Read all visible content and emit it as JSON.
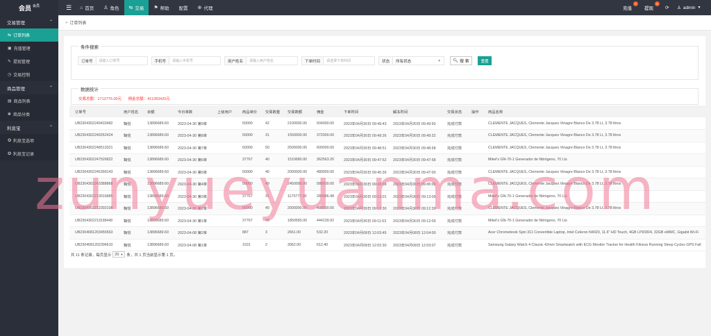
{
  "brand": {
    "title": "会员",
    "subtitle": "会员"
  },
  "topnav": [
    {
      "label": "首页",
      "icon": "home-icon",
      "glyph": "⌂"
    },
    {
      "label": "角色",
      "icon": "user-icon",
      "glyph": "♙"
    },
    {
      "label": "交易",
      "icon": "trade-icon",
      "glyph": "⇆"
    },
    {
      "label": "帮助",
      "icon": "flag-icon",
      "glyph": "⚑"
    },
    {
      "label": "配置",
      "icon": "config-icon",
      "glyph": ""
    },
    {
      "label": "代理",
      "icon": "agent-icon",
      "glyph": "⊕"
    }
  ],
  "topright": {
    "recharge": "充值",
    "recharge_badge": "0",
    "withdraw": "提现",
    "withdraw_badge": "0",
    "user": "admin"
  },
  "sidebar": {
    "groups": [
      {
        "label": "交易管理",
        "items": [
          {
            "label": "订单列表",
            "glyph": "⇆"
          },
          {
            "label": "充值管理",
            "glyph": "▣"
          },
          {
            "label": "提现管理",
            "glyph": "✎"
          },
          {
            "label": "交易控制",
            "glyph": "◷"
          }
        ]
      },
      {
        "label": "商品管理",
        "items": [
          {
            "label": "商品列表",
            "glyph": "▤"
          },
          {
            "label": "商品分类",
            "glyph": "❀"
          }
        ]
      },
      {
        "label": "利息宝",
        "items": [
          {
            "label": "利息宝选项",
            "glyph": "✪"
          },
          {
            "label": "利息宝记录",
            "glyph": "✪"
          }
        ]
      }
    ]
  },
  "tab": {
    "label": "订单列表"
  },
  "search": {
    "legend": "条件搜索",
    "order_no_label": "订单号",
    "order_no_placeholder": "请输入订单号",
    "phone_label": "手机号",
    "phone_placeholder": "请输入手机号",
    "name_label": "用户姓名",
    "name_placeholder": "请输入用户姓名",
    "time_label": "下单时间",
    "time_placeholder": "请选择下单时间",
    "status_label": "状态",
    "status_value": "所有状态",
    "search_button": "搜 索",
    "reset_button": "重置"
  },
  "stats": {
    "legend": "数据统计",
    "total": "交易总额：1713776.00元",
    "commission": "佣金总额：411283420元"
  },
  "table": {
    "headers": [
      "订单号",
      "用户姓名",
      "余额",
      "今日单数",
      "上级用户",
      "商品单价",
      "交易数量",
      "交易数额",
      "佣金",
      "下单时间",
      "解冻时间",
      "交易状态",
      "操作",
      "商品名称"
    ],
    "rows": [
      [
        "UB2304302249433482",
        "鞠悦",
        "13896689.60",
        "2023-04-30 第9单",
        "",
        "50000",
        "42",
        "2100000.00",
        "504000.00",
        "2023年04月30日 09:49:43",
        "2023年04月30日 09:49:50",
        "完成付款",
        "",
        "CLEMENTE JACQUES, Clemente Jacques Vinagre Blanco De 3.78 Lt, 3.78 litros"
      ],
      [
        "UB2304302249262424",
        "鞠悦",
        "13896689.60",
        "2023-04-30 第8单",
        "",
        "50000",
        "31",
        "1550000.00",
        "372000.00",
        "2023年04月30日 09:49:26",
        "2023年04月30日 09:49:32",
        "完成付款",
        "",
        "CLEMENTE JACQUES, Clemente Jacques Vinagre Blanco De 3.78 Lt, 3.78 litros"
      ],
      [
        "UB2304302248513321",
        "鞠悦",
        "13896689.60",
        "2023-04-30 第7单",
        "",
        "50000",
        "50",
        "2500000.00",
        "600000.00",
        "2023年04月30日 09:48:51",
        "2023年04月30日 09:48:58",
        "完成付款",
        "",
        "CLEMENTE JACQUES, Clemente Jacques Vinagre Blanco De 3.78 Lt, 3.78 litros"
      ],
      [
        "UB2304302247526822",
        "鞠悦",
        "13896689.60",
        "2023-04-30 第6单",
        "",
        "37767",
        "40",
        "1510680.00",
        "362563.20",
        "2023年04月30日 09:47:52",
        "2023年04月30日 09:47:58",
        "完成付款",
        "",
        "Mikel's GN-70-1 Generador de Nitrógeno, 70 Lts"
      ],
      [
        "UB2304302245399143",
        "鞠悦",
        "13896689.60",
        "2023-04-30 第5单",
        "",
        "50000",
        "40",
        "2000000.00",
        "480000.00",
        "2023年04月30日 09:45:39",
        "2023年04月30日 09:47:00",
        "完成付款",
        "",
        "CLEMENTE JACQUES, Clemente Jacques Vinagre Blanco De 3.78 Lt, 3.78 litros"
      ],
      [
        "UB2304302243388868",
        "鞠悦",
        "13896689.60",
        "2023-04-30 第4单",
        "",
        "50000",
        "49",
        "2450000.00",
        "588000.00",
        "2023年04月30日 09:43:38",
        "2023年04月30日 09:45:00",
        "完成付款",
        "",
        "CLEMENTE JACQUES, Clemente Jacques Vinagre Blanco De 3.78 Lt, 3.78 litros"
      ],
      [
        "UB2304302213016885",
        "鞠悦",
        "13896689.60",
        "2023-04-30 第3单",
        "",
        "37767",
        "31",
        "1170777.00",
        "280986.48",
        "2023年04月30日 09:13:01",
        "2023年04月30日 09:13:09",
        "完成付款",
        "",
        "Mikel's GN-70-1 Generador de Nitrógeno, 70 Lts"
      ],
      [
        "UB2304302212302108",
        "鞠悦",
        "13896689.60",
        "2023-04-30 第2单",
        "",
        "50000",
        "40",
        "2000000.00",
        "480000.00",
        "2023年04月30日 09:12:30",
        "2023年04月30日 09:12:39",
        "完成付款",
        "",
        "CLEMENTE JACQUES, Clemente Jacques Vinagre Blanco De 3.78 Lt, 3.78 litros"
      ],
      [
        "UB2304302211538449",
        "鞠悦",
        "13896689.60",
        "2023-04-30 第1单",
        "",
        "37767",
        "49",
        "1850583.00",
        "444139.92",
        "2023年04月30日 09:11:53",
        "2023年04月30日 09:12:09",
        "完成付款",
        "",
        "Mikel's GN-70-1 Generador de Nitrógeno, 70 Lts"
      ],
      [
        "UB2304081203455563",
        "鞠悦",
        "13896689.60",
        "2023-04-08 第2单",
        "",
        "887",
        "3",
        "2661.00",
        "532.20",
        "2023年04月08日 12:03:45",
        "2023年04月08日 12:04:00",
        "完成付款",
        "",
        "Acer Chromebook Spin 311 Convertible Laptop, Intel Celeron N4020, 11.6\" HD Touch, 4GB LPDDR4, 32GB eMMC, Gigabit Wi-Fi"
      ],
      [
        "UB2304081202306610",
        "鞠悦",
        "13896689.60",
        "2023-04-08 第1单",
        "",
        "1531",
        "2",
        "3062.00",
        "612.40",
        "2023年04月08日 12:02:30",
        "2023年04月08日 12:03:07",
        "完成付款",
        "",
        "Samsung Galaxy Watch 4 Classic 42mm Smartwatch with ECG Monitor Tracker for Health Fitness Running Sleep Cycles GPS Fall"
      ]
    ]
  },
  "pager": {
    "prefix": "共 11 条记录，每页显示",
    "page_size": "20",
    "suffix": "条，共 1 页当前显示第 1 页。"
  },
  "watermark": "zunyueyuanma.com",
  "colors": {
    "accent": "#1aa094",
    "topbar": "#323641",
    "sidebar": "#2b2f3a",
    "stat_red": "#ff3333"
  }
}
